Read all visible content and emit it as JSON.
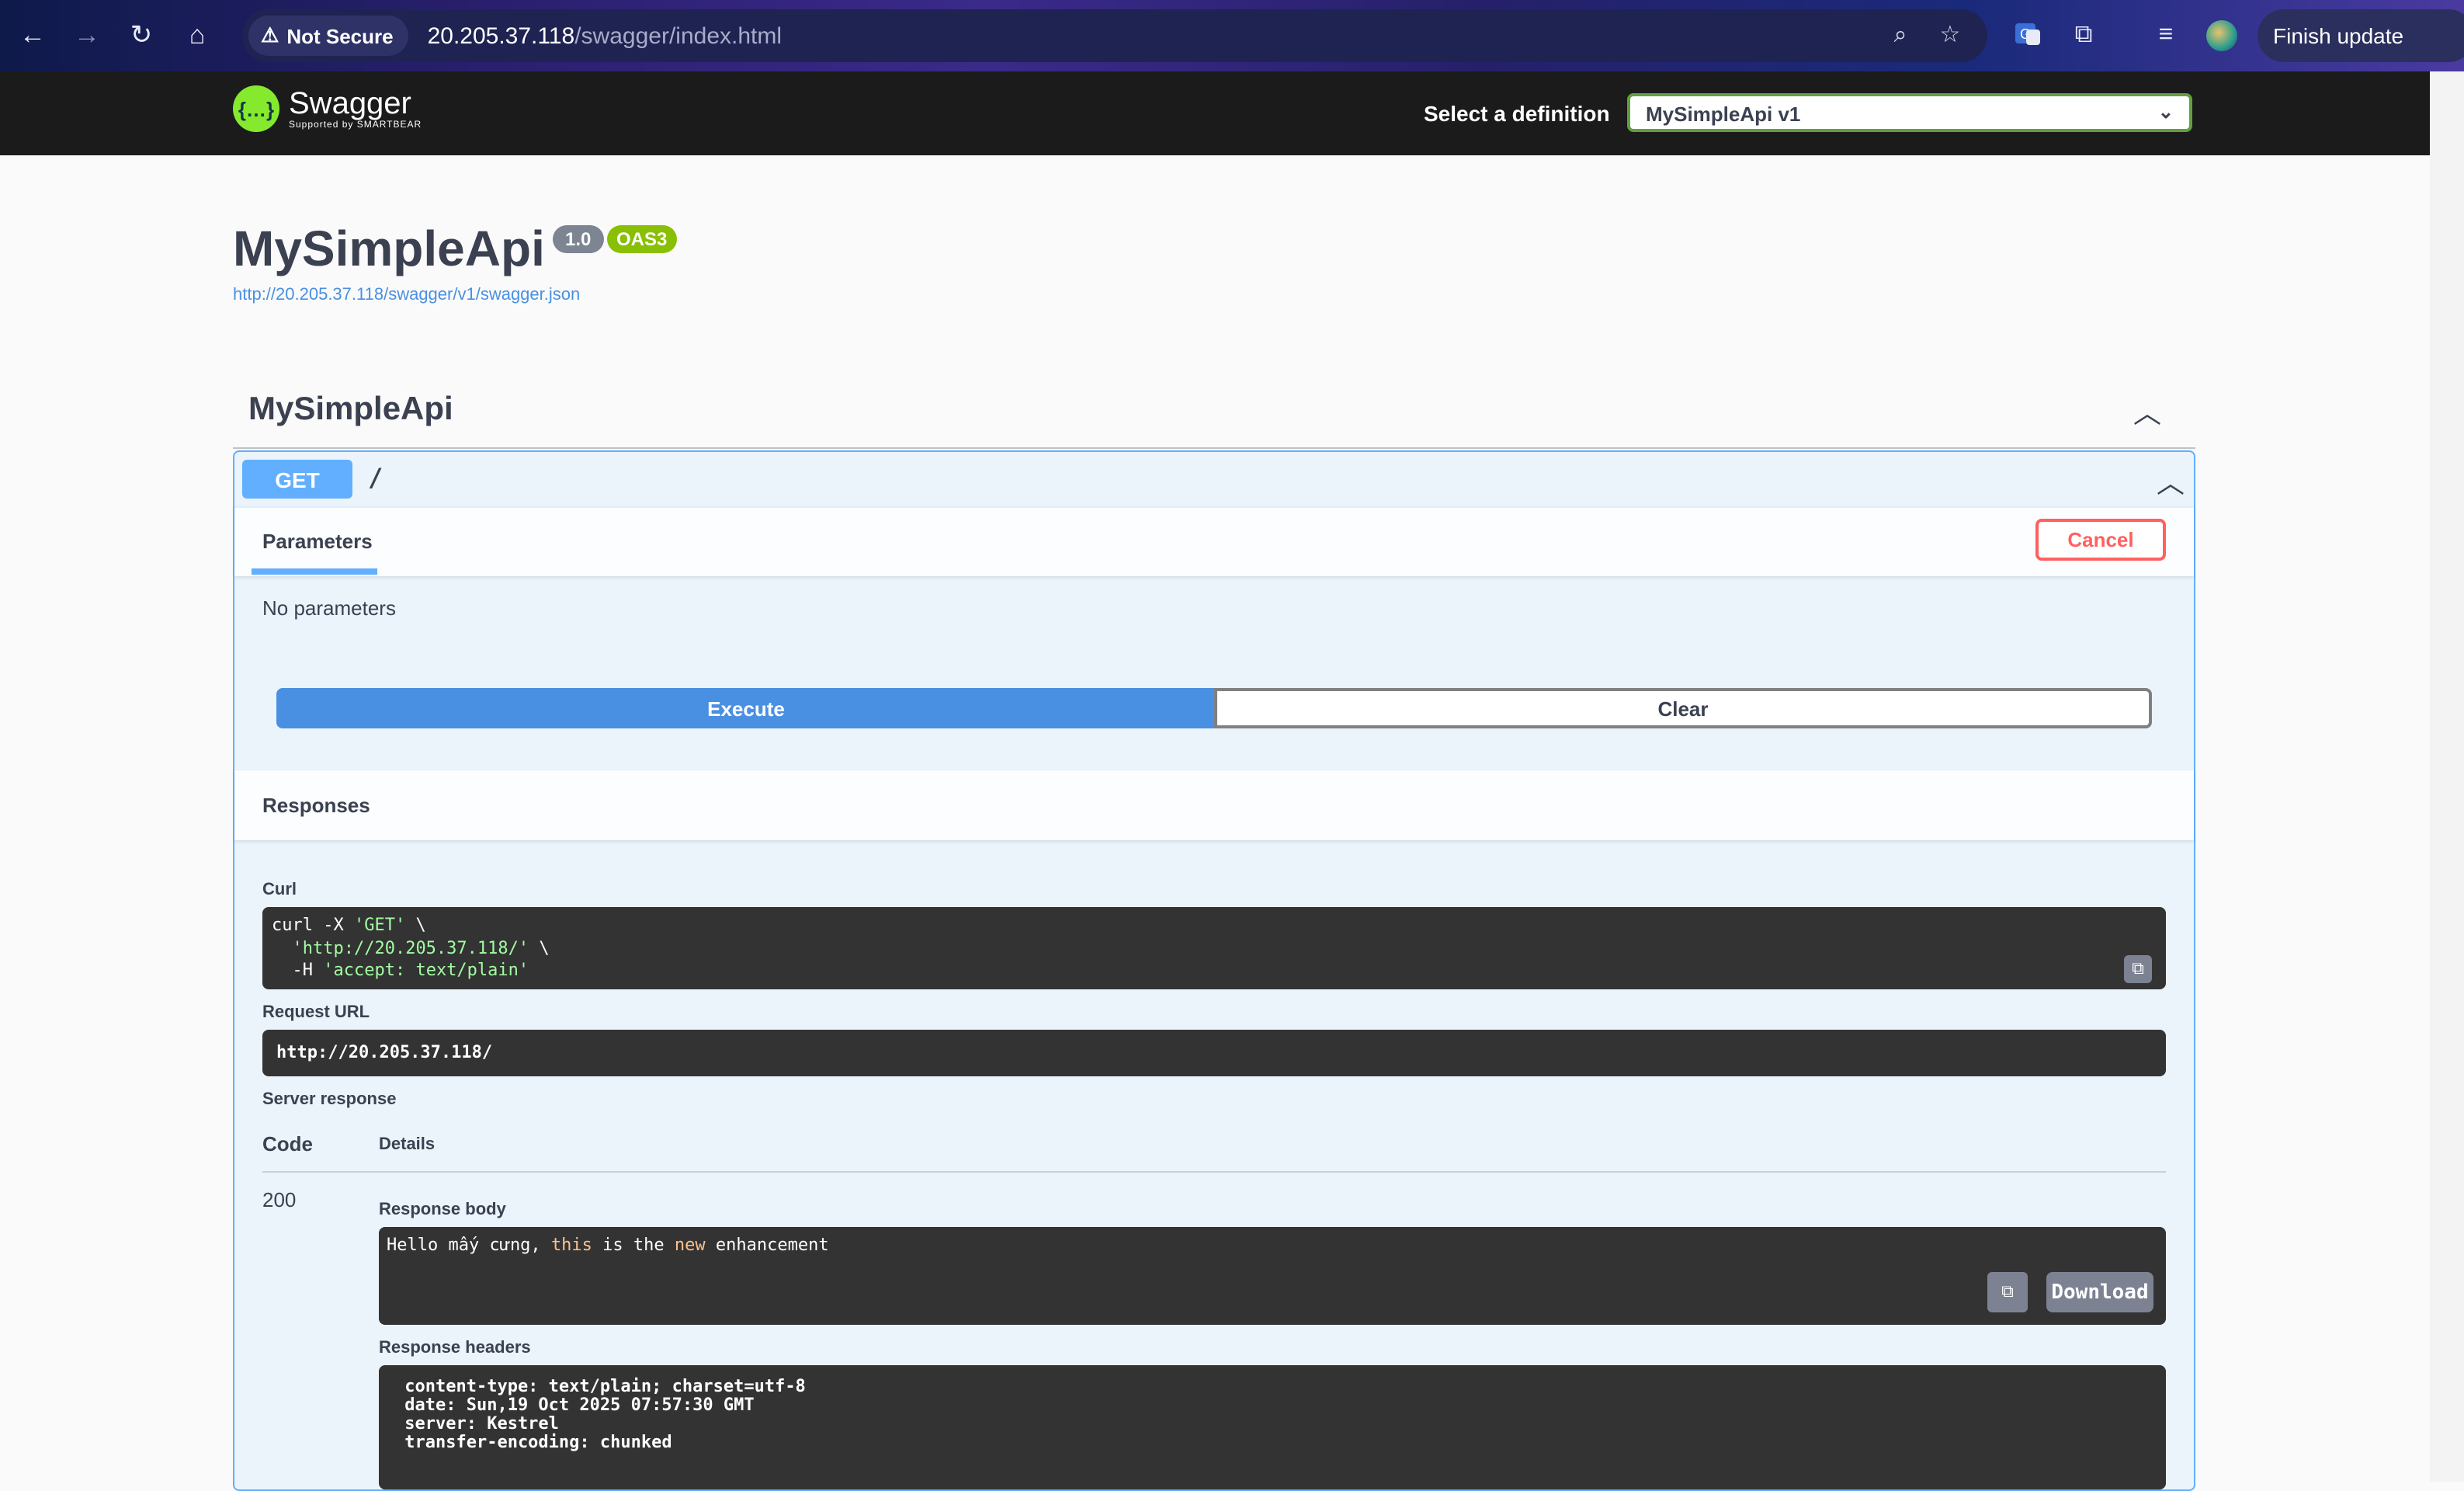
{
  "browser": {
    "not_secure_label": "Not Secure",
    "url_host": "20.205.37.118",
    "url_path": "/swagger/index.html",
    "finish_update_label": "Finish update"
  },
  "topbar": {
    "logo_text": "Swagger",
    "logo_subtext": "Supported by SMARTBEAR",
    "select_label": "Select a definition",
    "selected_definition": "MySimpleApi v1"
  },
  "info": {
    "title": "MySimpleApi",
    "version_badge": "1.0",
    "oas_badge": "OAS3",
    "spec_url": "http://20.205.37.118/swagger/v1/swagger.json"
  },
  "tag": {
    "name": "MySimpleApi"
  },
  "operation": {
    "method": "GET",
    "path": "/",
    "parameters_tab": "Parameters",
    "cancel_label": "Cancel",
    "no_parameters": "No parameters",
    "execute_label": "Execute",
    "clear_label": "Clear",
    "responses_title": "Responses",
    "curl_label": "Curl",
    "curl_lines": {
      "line1_cmd": "curl -X ",
      "line1_str": "'GET'",
      "line1_end": " \\",
      "line2_indent": "  ",
      "line2_str": "'http://20.205.37.118/'",
      "line2_end": " \\",
      "line3_cmd": "  -H ",
      "line3_str": "'accept: text/plain'"
    },
    "request_url_label": "Request URL",
    "request_url": "http://20.205.37.118/",
    "server_response_label": "Server response",
    "col_code": "Code",
    "col_details": "Details",
    "status_code": "200",
    "response_body_label": "Response body",
    "response_body": {
      "part1": "Hello mấy cưng, ",
      "kw1": "this",
      "part2": " is the ",
      "kw2": "new",
      "part3": " enhancement"
    },
    "download_label": "Download",
    "response_headers_label": "Response headers",
    "response_headers": [
      " content-type: text/plain; charset=utf-8 ",
      " date: Sun,19 Oct 2025 07:57:30 GMT ",
      " server: Kestrel ",
      " transfer-encoding: chunked "
    ]
  }
}
